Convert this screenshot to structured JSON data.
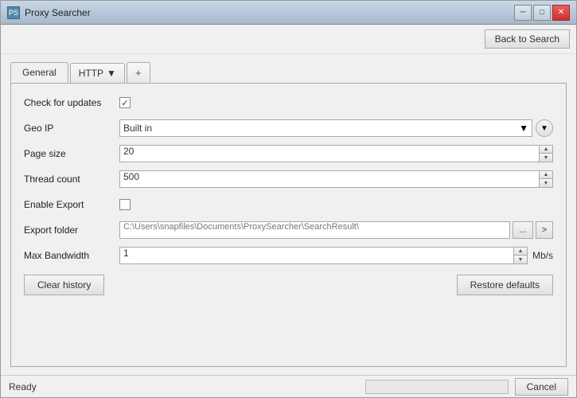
{
  "window": {
    "title": "Proxy Searcher",
    "icon": "PS"
  },
  "titlebar": {
    "minimize_label": "─",
    "restore_label": "□",
    "close_label": "✕"
  },
  "toolbar": {
    "back_to_search_label": "Back to Search"
  },
  "tabs": {
    "general_label": "General",
    "http_label": "HTTP",
    "add_label": "+"
  },
  "form": {
    "check_updates_label": "Check for updates",
    "check_updates_checked": true,
    "geo_ip_label": "Geo IP",
    "geo_ip_value": "Built in",
    "page_size_label": "Page size",
    "page_size_value": "20",
    "thread_count_label": "Thread count",
    "thread_count_value": "500",
    "enable_export_label": "Enable Export",
    "enable_export_checked": false,
    "export_folder_label": "Export folder",
    "export_folder_value": "C:\\Users\\snapfiles\\Documents\\ProxySearcher\\SearchResult\\",
    "max_bandwidth_label": "Max Bandwidth",
    "max_bandwidth_value": "1",
    "max_bandwidth_unit": "Mb/s"
  },
  "buttons": {
    "clear_history_label": "Clear history",
    "restore_defaults_label": "Restore defaults",
    "cancel_label": "Cancel"
  },
  "status": {
    "text": "Ready"
  }
}
